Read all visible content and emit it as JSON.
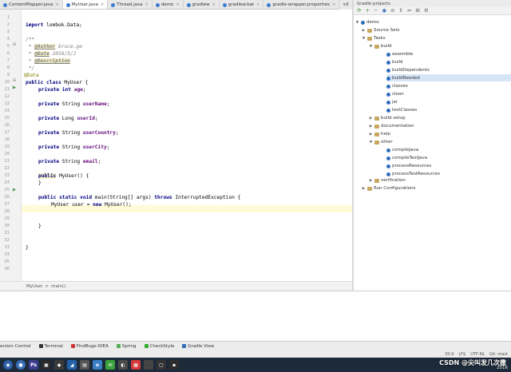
{
  "tabs": [
    {
      "label": "ContentMapper.java",
      "active": false
    },
    {
      "label": "MyUser.java",
      "active": true
    },
    {
      "label": "Thread.java",
      "active": false
    },
    {
      "label": "demo",
      "active": false
    },
    {
      "label": "gradlew",
      "active": false
    },
    {
      "label": "gradlew.bat",
      "active": false
    },
    {
      "label": "gradle-wrapper.properties",
      "active": false
    }
  ],
  "tab_overflow": "≡8",
  "editor": {
    "line_numbers": [
      "1",
      "2",
      "3",
      "4",
      "5",
      "6",
      "7",
      "8",
      "9",
      "10",
      "11",
      "12",
      "13",
      "14",
      "15",
      "16",
      "17",
      "18",
      "19",
      "20",
      "21",
      "22",
      "23",
      "24",
      "25",
      "26",
      "27",
      "28",
      "29",
      "30",
      "31",
      "32",
      "33",
      "34",
      "35",
      "36"
    ],
    "code": {
      "l2_kw": "import",
      "l2_rest": " lombok.Data;",
      "l4": "/**",
      "l5_star": " * ",
      "l5_tag": "@Author",
      "l5_val": " bruce.ge",
      "l6_star": " * ",
      "l6_tag": "@Date",
      "l6_val": " 2016/5/2",
      "l7_star": " * ",
      "l7_tag": "@Description",
      "l7_val": "",
      "l8": " */",
      "l9": "@Data",
      "l10_kw": "public class",
      "l10_rest": " MyUser {",
      "l11_kw": "private int",
      "l11_fld": "age",
      "l13_kw": "private",
      "l13_type": " String ",
      "l13_fld": "userName",
      "l15_kw": "private",
      "l15_type": " Long ",
      "l15_fld": "userId",
      "l17_kw": "private",
      "l17_type": " String ",
      "l17_fld": "userCountry",
      "l19_kw": "private",
      "l19_type": " String ",
      "l19_fld": "userCity",
      "l21_kw": "private",
      "l21_type": " String ",
      "l21_fld": "email",
      "l23_kw": "public",
      "l23_rest": " MyUser() {",
      "l24": "}",
      "l26_kw1": "public static void",
      "l26_mid": " main(String[] args) ",
      "l26_kw2": "throws",
      "l26_rest": " InterruptedException {",
      "l27_rest": "MyUser user = ",
      "l27_kw": "new",
      "l27_end": " MyUser();",
      "l31": "}",
      "l34": "}"
    }
  },
  "breadcrumb": [
    "MyUser",
    "main()"
  ],
  "breadcrumb_sep": ">",
  "gradle": {
    "title": "Gradle projects",
    "toolbar_icons": [
      "refresh-icon",
      "add-icon",
      "remove-icon",
      "execute-icon",
      "toggle-offline-icon",
      "expand-all-icon",
      "collapse-all-icon",
      "link-icon",
      "settings-icon"
    ],
    "tree": {
      "root": "demo",
      "source_sets": "Source Sets",
      "tasks": "Tasks",
      "build_group": "build",
      "build_tasks": [
        "assemble",
        "build",
        "buildDependents",
        "buildNeeded",
        "classes",
        "clean",
        "jar",
        "testClasses"
      ],
      "selected": "buildNeeded",
      "build_setup": "build setup",
      "documentation": "documentation",
      "help": "help",
      "other": "other",
      "other_tasks": [
        "compileJava",
        "compileTestJava",
        "processResources",
        "processTestResources"
      ],
      "verification": "verification",
      "run_configs": "Run Configurations"
    }
  },
  "toolwindows": [
    "ersion Control",
    "Terminal",
    "FindBugs-IDEA",
    "Spring",
    "CheckStyle",
    "Gradle View"
  ],
  "status": {
    "position": "30:9",
    "line_sep": "LF$",
    "encoding": "UTF-8$",
    "vcs": "Git: mast"
  },
  "watermark": "CSDN @尖叫发几次撒",
  "clock": "2016"
}
